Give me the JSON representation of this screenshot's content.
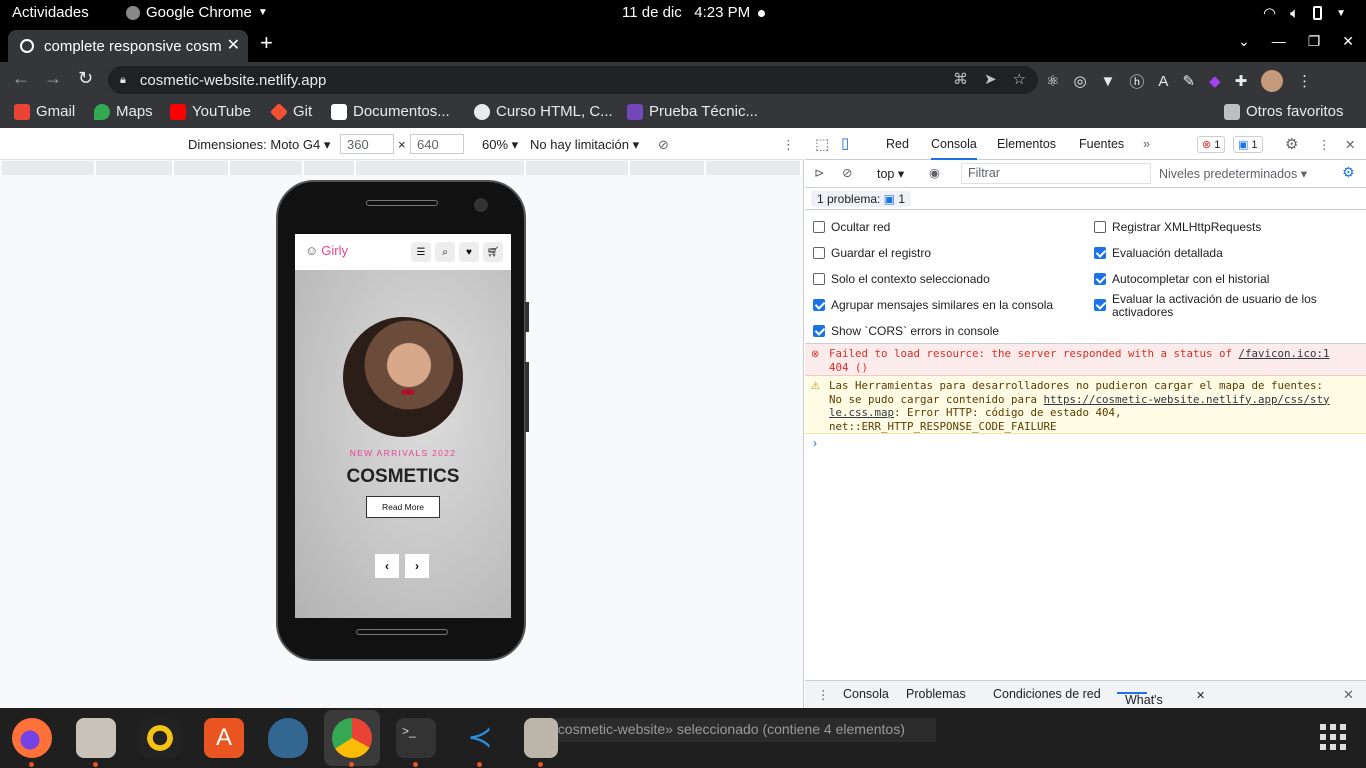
{
  "system": {
    "activities": "Actividades",
    "app_name": "Google Chrome",
    "date": "11 de dic",
    "time": "4:23 PM"
  },
  "browser": {
    "tab_title": "complete responsive cosm",
    "url": "cosmetic-website.netlify.app",
    "bookmarks": [
      {
        "label": "Gmail"
      },
      {
        "label": "Maps"
      },
      {
        "label": "YouTube"
      },
      {
        "label": "Git"
      },
      {
        "label": "Documentos..."
      },
      {
        "label": "Curso HTML, C..."
      },
      {
        "label": "Prueba Técnic..."
      }
    ],
    "other_bookmarks": "Otros favoritos"
  },
  "device_toolbar": {
    "dimensions_label": "Dimensiones: Moto G4",
    "width": "360",
    "times": "×",
    "height": "640",
    "zoom": "60%",
    "throttle": "No hay limitación"
  },
  "site": {
    "logo": "Girly",
    "subtitle": "NEW ARRIVALS 2022",
    "title": "COSMETICS",
    "button": "Read More"
  },
  "devtools": {
    "tabs": [
      "Red",
      "Consola",
      "Elementos",
      "Fuentes"
    ],
    "error_count": "1",
    "info_count": "1",
    "context": "top",
    "filter_placeholder": "Filtrar",
    "levels": "Niveles predeterminados",
    "problems_label": "1 problema:",
    "problems_count": "1",
    "options_left": [
      {
        "label": "Ocultar red",
        "checked": false
      },
      {
        "label": "Guardar el registro",
        "checked": false
      },
      {
        "label": "Solo el contexto seleccionado",
        "checked": false
      },
      {
        "label": "Agrupar mensajes similares en la consola",
        "checked": true
      },
      {
        "label": "Show `CORS` errors in console",
        "checked": true
      }
    ],
    "options_right": [
      {
        "label": "Registrar XMLHttpRequests",
        "checked": false
      },
      {
        "label": "Evaluación detallada",
        "checked": true
      },
      {
        "label": "Autocompletar con el historial",
        "checked": true
      },
      {
        "label": "Evaluar la activación de usuario de los activadores",
        "checked": true
      }
    ],
    "error_message": "Failed to load resource: the server responded with a status of",
    "error_link": "/favicon.ico:1",
    "error_tail": "404 ()",
    "warn_line1": "Las Herramientas para desarrolladores no pudieron cargar el mapa de fuentes:",
    "warn_line2": "No se pudo cargar contenido para",
    "warn_link1": "https://cosmetic-website.netlify.app/css/sty",
    "warn_link2": "le.css.map",
    "warn_line3": ": Error HTTP: código de estado 404,",
    "warn_line4": "net::ERR_HTTP_RESPONSE_CODE_FAILURE",
    "prompt": "›",
    "drawer_tabs": [
      "Consola",
      "Problemas",
      "Condiciones de red",
      "What's New"
    ]
  },
  "dock": {
    "toast": "«cosmetic-website» seleccionado  (contiene 4 elementos)"
  },
  "colors": {
    "accent_pink": "#e84393",
    "devtools_blue": "#1a73e8",
    "error_red": "#d93025",
    "ubuntu_orange": "#e95420"
  }
}
